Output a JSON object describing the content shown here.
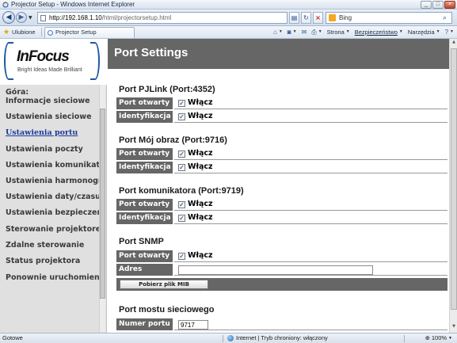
{
  "window": {
    "title": "Projector Setup - Windows Internet Explorer",
    "buttons": [
      "_",
      "□",
      "×"
    ]
  },
  "addressbar": {
    "url_host": "http://192.168.1.10",
    "url_path": "/html/projectorsetup.html",
    "search_placeholder": "Bing"
  },
  "favorites": {
    "label": "Ulubione",
    "tab_title": "Projector Setup",
    "commands": [
      "Strona",
      "Bezpieczeństwo",
      "Narzędzia"
    ]
  },
  "sidebar": {
    "logo_brand": "InFocus",
    "logo_tagline": "Bright Ideas Made Brilliant",
    "heading": "Góra:",
    "items": [
      {
        "label": "Informacje sieciowe",
        "active": false
      },
      {
        "label": "Ustawienia sieciowe",
        "active": false
      },
      {
        "label": "Ustawienia portu",
        "active": true
      },
      {
        "label": "Ustawienia poczty",
        "active": false
      },
      {
        "label": "Ustawienia komunikatów",
        "active": false
      },
      {
        "label": "Ustawienia harmonogramu",
        "active": false
      },
      {
        "label": "Ustawienia daty/czasu",
        "active": false
      },
      {
        "label": "Ustawienia bezpieczeństwa",
        "active": false
      },
      {
        "label": "Sterowanie projektorem",
        "active": false
      },
      {
        "label": "Zdalne sterowanie",
        "active": false
      },
      {
        "label": "Status projektora",
        "active": false
      },
      {
        "label": "Ponownie uruchomienie",
        "active": false
      }
    ]
  },
  "main": {
    "page_title": "Port Settings",
    "sections": {
      "pjlink": {
        "title": "Port PJLink (Port:4352)",
        "open_label": "Port otwarty",
        "open_value": "Włącz",
        "ident_label": "Identyfikacja",
        "ident_value": "Włącz"
      },
      "myimage": {
        "title": "Port Mój obraz (Port:9716)",
        "open_label": "Port otwarty",
        "open_value": "Włącz",
        "ident_label": "Identyfikacja",
        "ident_value": "Włącz"
      },
      "messenger": {
        "title": "Port komunikatora (Port:9719)",
        "open_label": "Port otwarty",
        "open_value": "Włącz",
        "ident_label": "Identyfikacja",
        "ident_value": "Włącz"
      },
      "snmp": {
        "title": "Port SNMP",
        "open_label": "Port otwarty",
        "open_value": "Włącz",
        "trap_label": "Adres pułapki",
        "trap_value": "",
        "mib_button": "Pobierz plik MIB"
      },
      "bridge": {
        "title": "Port mostu sieciowego",
        "port_label": "Numer portu",
        "port_value": "9717"
      }
    }
  },
  "statusbar": {
    "left": "Gotowe",
    "zone": "Internet | Tryb chroniony: włączony",
    "zoom": "100%"
  }
}
